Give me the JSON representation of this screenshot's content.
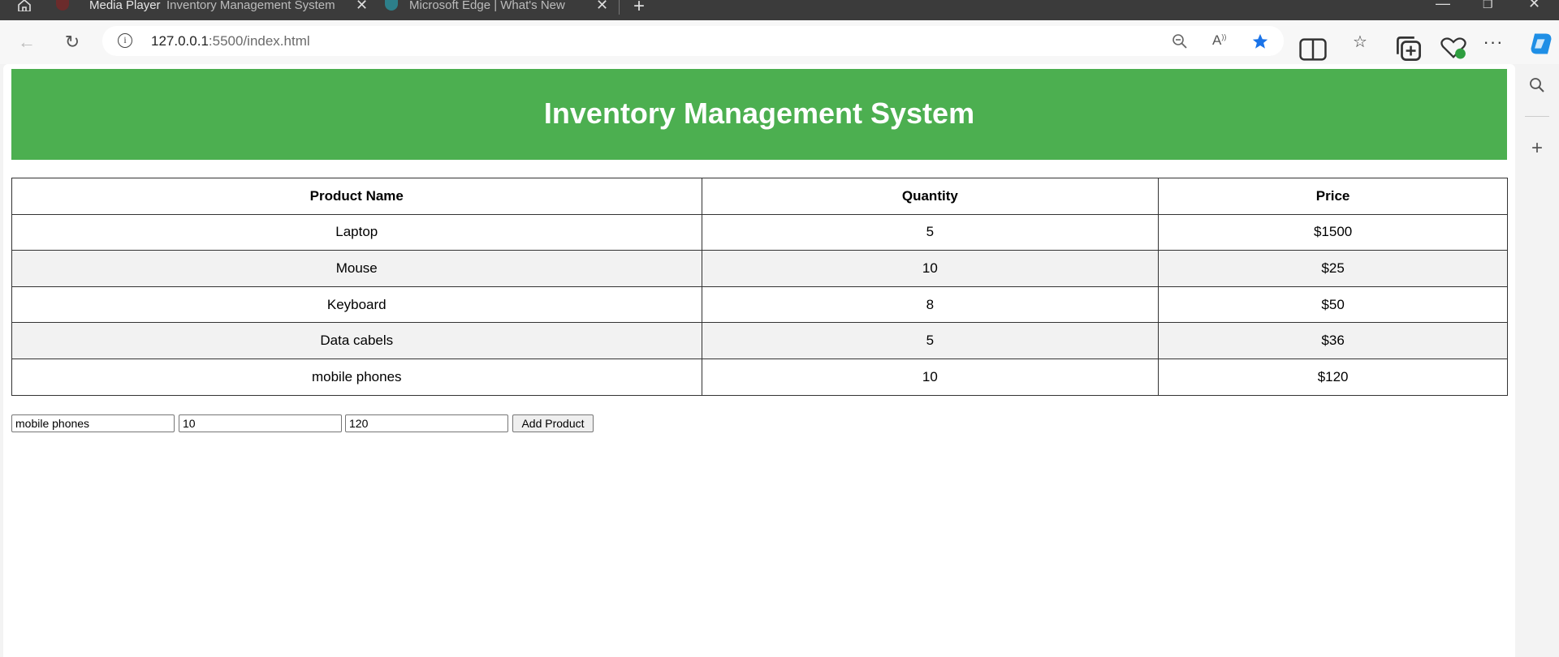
{
  "browser": {
    "tabs": [
      {
        "label": "Media Player"
      },
      {
        "label": "Inventory Management System",
        "close": "✕"
      },
      {
        "label": "Microsoft Edge | What's New",
        "close": "✕"
      }
    ],
    "new_tab": "+",
    "window_controls": {
      "minimize": "—",
      "restore": "❐",
      "close": "✕"
    },
    "url": {
      "host": "127.0.0.1",
      "path": ":5500/index.html"
    },
    "info_glyph": "i"
  },
  "icons": {
    "home": "home-icon",
    "back": "back-arrow-icon",
    "refresh": "refresh-icon",
    "zoom_out": "zoom-out-icon",
    "read_aloud": "read-aloud-icon",
    "favorite": "star-filled-icon",
    "split": "split-screen-icon",
    "favorites": "favorites-icon",
    "collections": "collections-icon",
    "performance": "browser-essentials-icon",
    "more": "more-icon",
    "copilot": "copilot-icon",
    "search": "search-icon",
    "add": "plus-icon"
  },
  "colors": {
    "header_bg": "#4caf50",
    "header_text": "#ffffff",
    "row_alt": "#f2f2f2",
    "favorite_star": "#1a73e8"
  },
  "page": {
    "title": "Inventory Management System",
    "table": {
      "headers": [
        "Product Name",
        "Quantity",
        "Price"
      ],
      "rows": [
        [
          "Laptop",
          "5",
          "$1500"
        ],
        [
          "Mouse",
          "10",
          "$25"
        ],
        [
          "Keyboard",
          "8",
          "$50"
        ],
        [
          "Data cabels",
          "5",
          "$36"
        ],
        [
          "mobile phones",
          "10",
          "$120"
        ]
      ]
    },
    "form": {
      "name_value": "mobile phones",
      "quantity_value": "10",
      "price_value": "120",
      "submit_label": "Add Product"
    }
  }
}
